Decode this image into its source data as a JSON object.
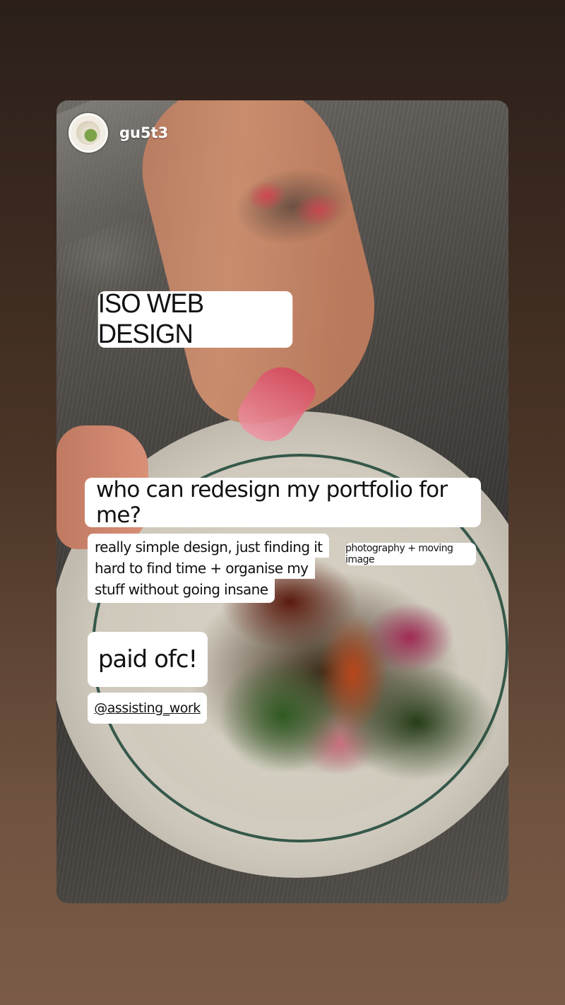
{
  "story": {
    "username": "gu5t3",
    "avatar_icon": "dish-avatar-icon",
    "background_color": "#4a3426"
  },
  "stickers": {
    "headline": "ISO WEB DESIGN",
    "question": "who can redesign my portfolio for me?",
    "details": [
      "really simple design, just finding it",
      "hard to find time + organise my",
      "stuff without going insane"
    ],
    "tags": "photography + moving image",
    "paid": "paid ofc!",
    "mention": "@assisting_work"
  }
}
